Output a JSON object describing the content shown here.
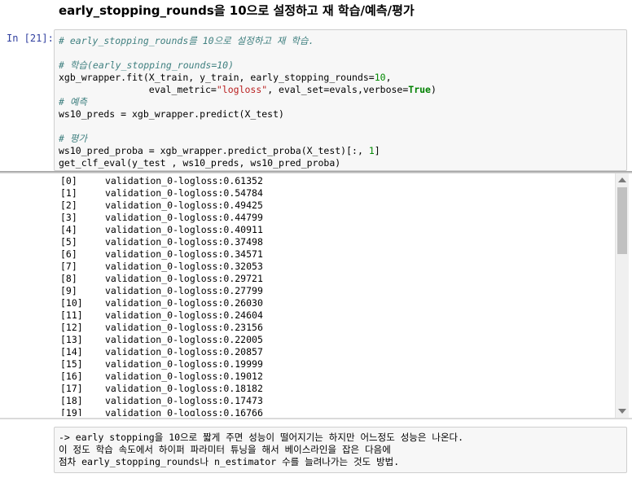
{
  "heading": "early_stopping_rounds을 10으로 설정하고 재 학습/예측/평가",
  "prompt": "In [21]:",
  "code": {
    "l1": "# early_stopping_rounds를 10으로 설정하고 재 학습.",
    "l3": "# 학습(early_stopping_rounds=10)",
    "l4_a": "xgb_wrapper.fit(X_train, y_train, early_stopping_rounds=",
    "l4_num": "10",
    "l4_b": ",",
    "l5_a": "                eval_metric=",
    "l5_str": "\"logloss\"",
    "l5_b": ", eval_set=evals,verbose=",
    "l5_kw": "True",
    "l5_c": ")",
    "l6": "# 예측",
    "l7": "ws10_preds = xgb_wrapper.predict(X_test)",
    "l9": "# 평가",
    "l10_a": "ws10_pred_proba = xgb_wrapper.predict_proba(X_test)[:, ",
    "l10_num": "1",
    "l10_b": "]",
    "l11": "get_clf_eval(y_test , ws10_preds, ws10_pred_proba)"
  },
  "output": {
    "metric_label": "validation_0-logloss:",
    "rows": [
      {
        "idx": "[0]",
        "val": "0.61352"
      },
      {
        "idx": "[1]",
        "val": "0.54784"
      },
      {
        "idx": "[2]",
        "val": "0.49425"
      },
      {
        "idx": "[3]",
        "val": "0.44799"
      },
      {
        "idx": "[4]",
        "val": "0.40911"
      },
      {
        "idx": "[5]",
        "val": "0.37498"
      },
      {
        "idx": "[6]",
        "val": "0.34571"
      },
      {
        "idx": "[7]",
        "val": "0.32053"
      },
      {
        "idx": "[8]",
        "val": "0.29721"
      },
      {
        "idx": "[9]",
        "val": "0.27799"
      },
      {
        "idx": "[10]",
        "val": "0.26030"
      },
      {
        "idx": "[11]",
        "val": "0.24604"
      },
      {
        "idx": "[12]",
        "val": "0.23156"
      },
      {
        "idx": "[13]",
        "val": "0.22005"
      },
      {
        "idx": "[14]",
        "val": "0.20857"
      },
      {
        "idx": "[15]",
        "val": "0.19999"
      },
      {
        "idx": "[16]",
        "val": "0.19012"
      },
      {
        "idx": "[17]",
        "val": "0.18182"
      },
      {
        "idx": "[18]",
        "val": "0.17473"
      },
      {
        "idx": "[19]",
        "val": "0.16766"
      }
    ]
  },
  "markdown": {
    "l1": "-> early stopping을 10으로 짧게 주면 성능이 떨어지기는 하지만 어느정도 성능은 나온다.",
    "l2": "이 정도 학습 속도에서 하이퍼 파라미터 튜닝을 해서 베이스라인을 잡은 다음에",
    "l3": "점차 early_stopping_rounds나 n_estimator 수를 늘려나가는 것도 방법."
  }
}
